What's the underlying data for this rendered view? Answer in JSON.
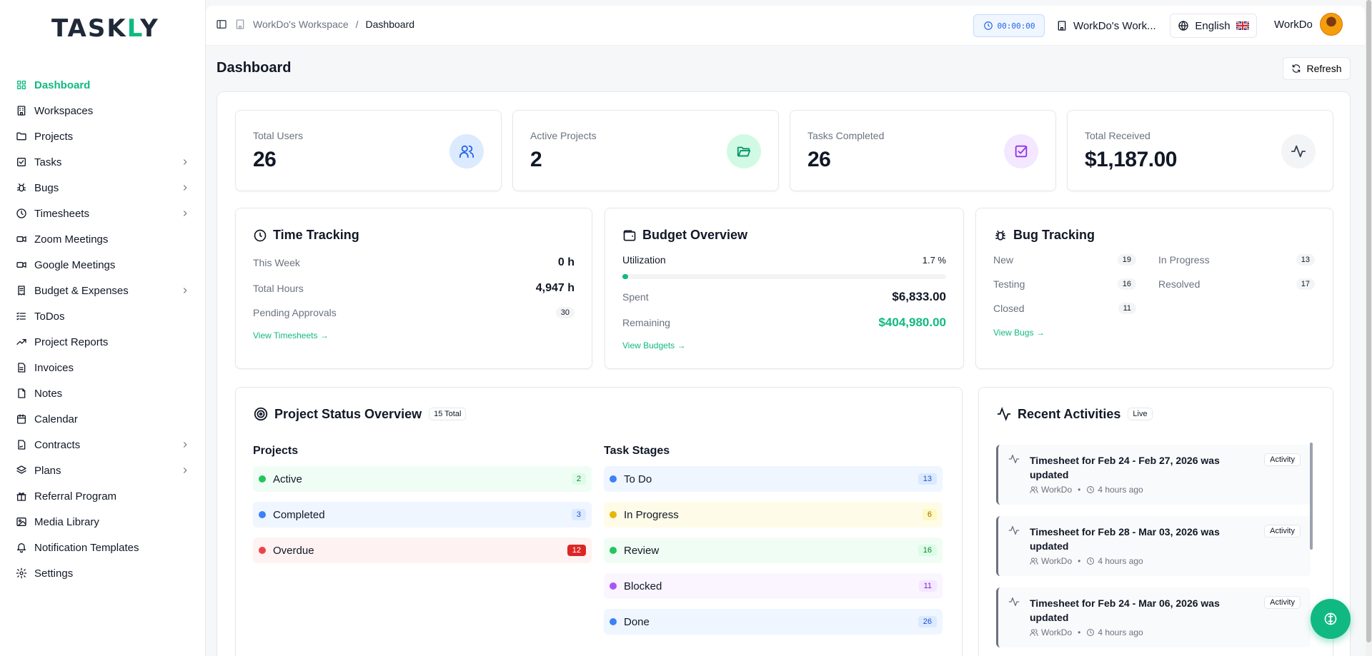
{
  "app": {
    "logo": {
      "part1": "TASK",
      "part2": "L",
      "part3": "Y"
    }
  },
  "sidebar": {
    "items": [
      {
        "label": "Dashboard",
        "icon": "grid-icon",
        "active": true,
        "chevron": false
      },
      {
        "label": "Workspaces",
        "icon": "building-icon",
        "chevron": false
      },
      {
        "label": "Projects",
        "icon": "folder-icon",
        "chevron": false
      },
      {
        "label": "Tasks",
        "icon": "checkbox-icon",
        "chevron": true
      },
      {
        "label": "Bugs",
        "icon": "bug-icon",
        "chevron": true
      },
      {
        "label": "Timesheets",
        "icon": "clock-icon",
        "chevron": true
      },
      {
        "label": "Zoom Meetings",
        "icon": "video-icon",
        "chevron": false
      },
      {
        "label": "Google Meetings",
        "icon": "video-icon",
        "chevron": false
      },
      {
        "label": "Budget & Expenses",
        "icon": "receipt-icon",
        "chevron": true
      },
      {
        "label": "ToDos",
        "icon": "list-icon",
        "chevron": false
      },
      {
        "label": "Project Reports",
        "icon": "trending-up-icon",
        "chevron": false
      },
      {
        "label": "Invoices",
        "icon": "file-text-icon",
        "chevron": false
      },
      {
        "label": "Notes",
        "icon": "file-icon",
        "chevron": false
      },
      {
        "label": "Calendar",
        "icon": "calendar-icon",
        "chevron": false
      },
      {
        "label": "Contracts",
        "icon": "file-signature-icon",
        "chevron": true
      },
      {
        "label": "Plans",
        "icon": "layers-icon",
        "chevron": true
      },
      {
        "label": "Referral Program",
        "icon": "gift-icon",
        "chevron": false
      },
      {
        "label": "Media Library",
        "icon": "image-icon",
        "chevron": false
      },
      {
        "label": "Notification Templates",
        "icon": "bell-icon",
        "chevron": false
      },
      {
        "label": "Settings",
        "icon": "gear-icon",
        "chevron": false
      }
    ]
  },
  "header": {
    "breadcrumb_root": "WorkDo's Workspace",
    "breadcrumb_sep": "/",
    "breadcrumb_current": "Dashboard",
    "timer": "00:00:00",
    "workspace": "WorkDo's Work...",
    "language": "English",
    "user_name": "WorkDo"
  },
  "page": {
    "title": "Dashboard",
    "refresh_label": "Refresh"
  },
  "stats": [
    {
      "label": "Total Users",
      "value": "26",
      "icon": "users-icon",
      "bg": "#dbeafe",
      "fg": "#2563eb"
    },
    {
      "label": "Active Projects",
      "value": "2",
      "icon": "folder-open-icon",
      "bg": "#d1fae5",
      "fg": "#059669"
    },
    {
      "label": "Tasks Completed",
      "value": "26",
      "icon": "check-square-icon",
      "bg": "#f3e8ff",
      "fg": "#9333ea"
    },
    {
      "label": "Total Received",
      "value": "$1,187.00",
      "icon": "activity-icon",
      "bg": "#f3f4f6",
      "fg": "#374151"
    }
  ],
  "time_tracking": {
    "title": "Time Tracking",
    "this_week_label": "This Week",
    "this_week_value": "0 h",
    "total_hours_label": "Total Hours",
    "total_hours_value": "4,947 h",
    "pending_label": "Pending Approvals",
    "pending_value": "30",
    "link": "View Timesheets →"
  },
  "budget": {
    "title": "Budget Overview",
    "utilization_label": "Utilization",
    "utilization_value": "1.7 %",
    "utilization_pct": 1.7,
    "spent_label": "Spent",
    "spent_value": "$6,833.00",
    "remaining_label": "Remaining",
    "remaining_value": "$404,980.00",
    "link": "View Budgets →"
  },
  "bugs": {
    "title": "Bug Tracking",
    "cells": [
      {
        "label": "New",
        "value": "19"
      },
      {
        "label": "In Progress",
        "value": "13"
      },
      {
        "label": "Testing",
        "value": "16"
      },
      {
        "label": "Resolved",
        "value": "17"
      },
      {
        "label": "Closed",
        "value": "11"
      }
    ],
    "link": "View Bugs →"
  },
  "project_status": {
    "title": "Project Status Overview",
    "badge": "15 Total",
    "projects_heading": "Projects",
    "stages_heading": "Task Stages",
    "projects": [
      {
        "label": "Active",
        "count": "2",
        "dot": "#22c55e",
        "bg": "#f0fdf4",
        "cbg": "#dcfce7",
        "cfg": "#15803d"
      },
      {
        "label": "Completed",
        "count": "3",
        "dot": "#3b82f6",
        "bg": "#eff6ff",
        "cbg": "#dbeafe",
        "cfg": "#1d4ed8"
      },
      {
        "label": "Overdue",
        "count": "12",
        "dot": "#ef4444",
        "bg": "#fef2f2",
        "cbg": "#dc2626",
        "cfg": "#ffffff"
      }
    ],
    "stages": [
      {
        "label": "To Do",
        "count": "13",
        "dot": "#3b82f6",
        "bg": "#eff6ff",
        "cbg": "#dbeafe",
        "cfg": "#1d4ed8"
      },
      {
        "label": "In Progress",
        "count": "6",
        "dot": "#eab308",
        "bg": "#fefce8",
        "cbg": "#fef9c3",
        "cfg": "#a16207"
      },
      {
        "label": "Review",
        "count": "16",
        "dot": "#22c55e",
        "bg": "#f0fdf4",
        "cbg": "#dcfce7",
        "cfg": "#15803d"
      },
      {
        "label": "Blocked",
        "count": "11",
        "dot": "#a855f7",
        "bg": "#faf5ff",
        "cbg": "#f3e8ff",
        "cfg": "#7e22ce"
      },
      {
        "label": "Done",
        "count": "26",
        "dot": "#3b82f6",
        "bg": "#eff6ff",
        "cbg": "#dbeafe",
        "cfg": "#1d4ed8"
      }
    ]
  },
  "activities": {
    "title": "Recent Activities",
    "badge": "Live",
    "items": [
      {
        "title": "Timesheet for Feb 24 - Feb 27, 2026 was updated",
        "badge": "Activity",
        "user": "WorkDo",
        "time": "4 hours ago"
      },
      {
        "title": "Timesheet for Feb 28 - Mar 03, 2026 was updated",
        "badge": "Activity",
        "user": "WorkDo",
        "time": "4 hours ago"
      },
      {
        "title": "Timesheet for Feb 24 - Mar 06, 2026 was updated",
        "badge": "Activity",
        "user": "WorkDo",
        "time": "4 hours ago"
      }
    ]
  }
}
